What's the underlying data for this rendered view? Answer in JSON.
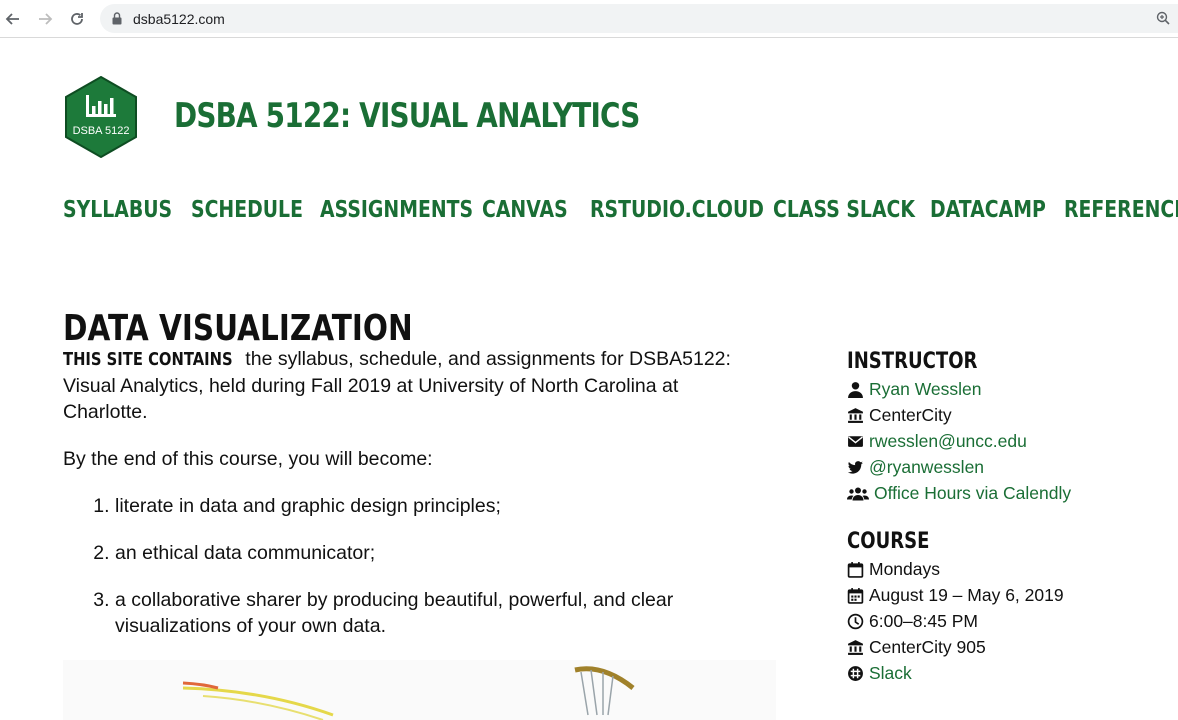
{
  "browser": {
    "url": "dsba5122.com"
  },
  "site": {
    "logo_text": "DSBA 5122",
    "title": "DSBA 5122: VISUAL ANALYTICS",
    "menu": [
      "SYLLABUS",
      "SCHEDULE",
      "ASSIGNMENTS",
      "CANVAS",
      "RSTUDIO.CLOUD",
      "CLASS SLACK",
      "DATACAMP",
      "REFERENCE"
    ]
  },
  "main": {
    "title": "DATA VISUALIZATION",
    "intro_lead": "THIS SITE CONTAINS",
    "intro_rest": " the syllabus, schedule, and assignments for DSBA5122: Visual Analytics, held during Fall 2019 at University of North Carolina at Charlotte.",
    "become": "By the end of this course, you will become:",
    "goals": [
      "literate in data and graphic design principles;",
      "an ethical data communicator;",
      "a collaborative sharer by producing beautiful, powerful, and clear visualizations of your own data."
    ]
  },
  "sidebar": {
    "instructor_heading": "INSTRUCTOR",
    "instructor": {
      "name": "Ryan Wesslen",
      "location": "CenterCity",
      "email": "rwesslen@uncc.edu",
      "twitter": "@ryanwesslen",
      "office_hours": "Office Hours via Calendly"
    },
    "course_heading": "COURSE",
    "course": {
      "day": "Mondays",
      "dates": "August 19 – May 6, 2019",
      "time": "6:00–8:45 PM",
      "room": "CenterCity 905",
      "slack": "Slack"
    }
  },
  "colors": {
    "brand_green": "#1a6e35",
    "text": "#111111"
  }
}
